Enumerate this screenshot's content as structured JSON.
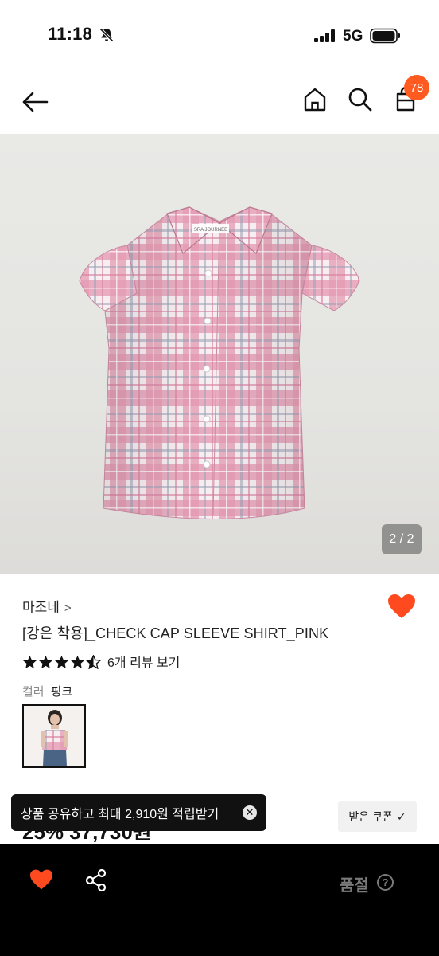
{
  "status_bar": {
    "time": "11:18",
    "network": "5G"
  },
  "header": {
    "cart_count": "78"
  },
  "gallery": {
    "counter": "2 / 2",
    "garment_label": "SRA JOURNEE"
  },
  "product": {
    "brand": "마조네",
    "brand_chevron": ">",
    "name": "[강은 착용]_CHECK CAP SLEEVE SHIRT_PINK",
    "rating": 4.5,
    "review_link": "6개 리뷰 보기",
    "option_label": "컬러",
    "option_value": "핑크"
  },
  "price": {
    "visible_text": "25% 37,730원"
  },
  "coupon": {
    "label": "받은 쿠폰",
    "check": "✓"
  },
  "toast": {
    "message": "상품 공유하고 최대 2,910원 적립받기",
    "close": "✕"
  },
  "bottom_bar": {
    "status": "품절",
    "help": "?"
  },
  "colors": {
    "accent": "#ff5a1f",
    "heart": "#ff4a1f",
    "pink_check": "#e8a0b8"
  },
  "icons": [
    "bell-slash-icon",
    "signal-icon",
    "battery-icon",
    "back-arrow-icon",
    "home-icon",
    "search-icon",
    "cart-icon",
    "heart-icon",
    "star-icon",
    "share-icon",
    "close-icon",
    "check-icon",
    "help-icon"
  ]
}
